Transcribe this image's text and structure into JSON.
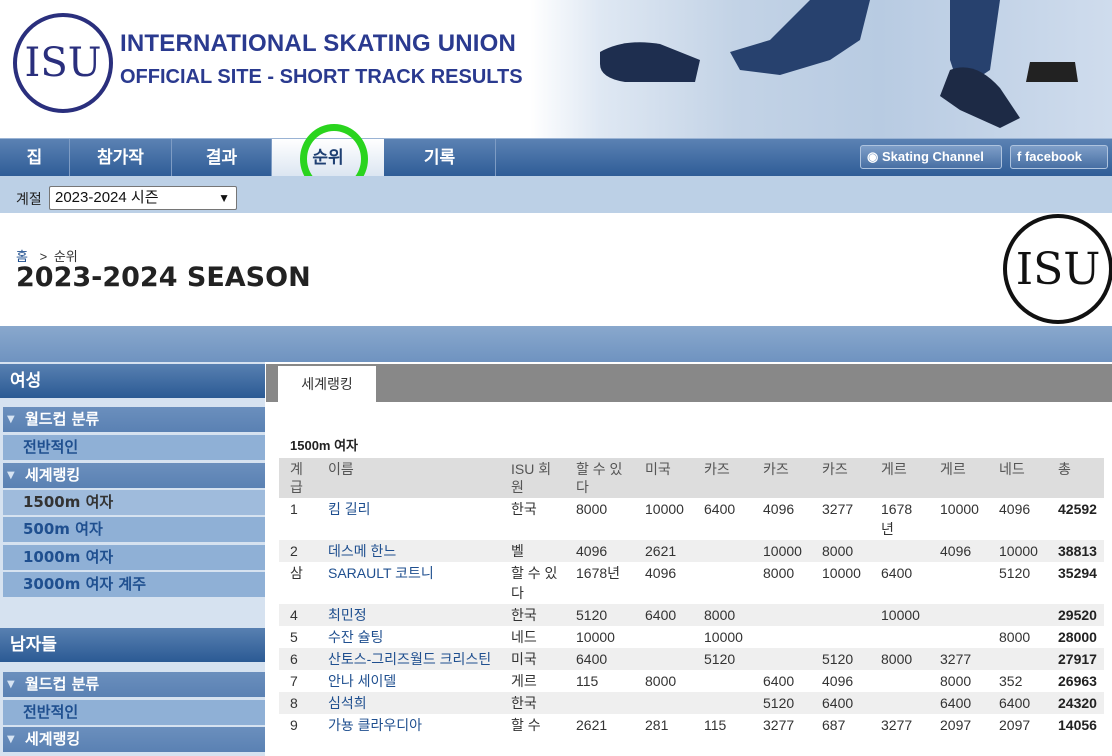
{
  "brand": {
    "line1": "INTERNATIONAL SKATING UNION",
    "line2": "OFFICIAL SITE - SHORT TRACK RESULTS",
    "logo_text": "ISU"
  },
  "nav": {
    "items": [
      "집",
      "참가작",
      "결과",
      "순위",
      "기록"
    ],
    "active": "순위",
    "skating_channel": "Skating Channel",
    "facebook": "facebook"
  },
  "season": {
    "label": "계절",
    "selected": "2023-2024 시즌"
  },
  "breadcrumb": {
    "home": "홈",
    "sep": ">",
    "current": "순위"
  },
  "page_title": "2023-2024 SEASON",
  "sidebar": {
    "women_head": "여성",
    "women": {
      "worldcup": "월드컵 분류",
      "overall": "전반적인",
      "ranking": "세계랭킹",
      "d1500": "1500m 여자",
      "d500": "500m 여자",
      "d1000": "1000m 여자",
      "d3000": "3000m 여자 계주"
    },
    "men_head": "남자들",
    "men": {
      "worldcup": "월드컵 분류",
      "overall": "전반적인",
      "ranking": "세계랭킹"
    }
  },
  "content": {
    "tab": "세계랭킹",
    "table_title": "1500m 여자",
    "headers": [
      "계급",
      "이름",
      "ISU 회원",
      "할 수 있다",
      "미국",
      "카즈",
      "카즈",
      "카즈",
      "게르",
      "게르",
      "네드",
      "총"
    ],
    "rows": [
      [
        "1",
        "킴 길리",
        "한국",
        "8000",
        "10000",
        "6400",
        "4096",
        "3277",
        "1678년",
        "10000",
        "4096",
        "42592"
      ],
      [
        "2",
        "데스메 한느",
        "벨",
        "4096",
        "2621",
        "",
        "10000",
        "8000",
        "",
        "4096",
        "10000",
        "38813"
      ],
      [
        "삼",
        "SARAULT 코트니",
        "할 수 있다",
        "1678년",
        "4096",
        "",
        "8000",
        "10000",
        "6400",
        "",
        "5120",
        "35294"
      ],
      [
        "4",
        "최민정",
        "한국",
        "5120",
        "6400",
        "8000",
        "",
        "",
        "10000",
        "",
        "",
        "29520"
      ],
      [
        "5",
        "수잔 슐팅",
        "네드",
        "10000",
        "",
        "10000",
        "",
        "",
        "",
        "",
        "8000",
        "28000"
      ],
      [
        "6",
        "산토스-그리즈월드 크리스틴",
        "미국",
        "6400",
        "",
        "5120",
        "",
        "5120",
        "8000",
        "3277",
        "",
        "27917"
      ],
      [
        "7",
        "안나 세이델",
        "게르",
        "115",
        "8000",
        "",
        "6400",
        "4096",
        "",
        "8000",
        "352",
        "26963"
      ],
      [
        "8",
        "심석희",
        "한국",
        "",
        "",
        "",
        "5120",
        "6400",
        "",
        "6400",
        "6400",
        "24320"
      ],
      [
        "9",
        "가뇽 클라우디아",
        "할 수",
        "2621",
        "281",
        "115",
        "3277",
        "687",
        "3277",
        "2097",
        "2097",
        "14056"
      ]
    ]
  }
}
